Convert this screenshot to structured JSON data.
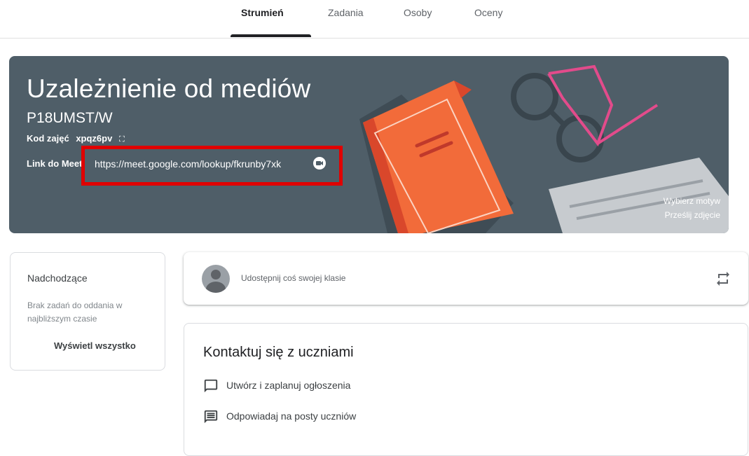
{
  "tabs": [
    {
      "label": "Strumień",
      "active": true
    },
    {
      "label": "Zadania",
      "active": false
    },
    {
      "label": "Osoby",
      "active": false
    },
    {
      "label": "Oceny",
      "active": false
    }
  ],
  "banner": {
    "title": "Uzależnienie od mediów",
    "section": "P18UMST/W",
    "code_label": "Kod zajęć",
    "code_value": "xpqz6pv",
    "link_label": "Link do Meet",
    "link_url": "https://meet.google.com/lookup/fkrunby7xk",
    "select_theme": "Wybierz motyw",
    "upload_photo": "Prześlij zdjęcie",
    "background_color": "#4f5e68"
  },
  "upcoming": {
    "heading": "Nadchodzące",
    "empty_text": "Brak zadań do oddania w najbliższym czasie",
    "view_all": "Wyświetl wszystko"
  },
  "share": {
    "placeholder": "Udostępnij coś swojej klasie"
  },
  "contact": {
    "heading": "Kontaktuj się z uczniami",
    "items": [
      {
        "icon": "announcement-icon",
        "label": "Utwórz i zaplanuj ogłoszenia"
      },
      {
        "icon": "comments-icon",
        "label": "Odpowiadaj na posty uczniów"
      }
    ]
  },
  "colors": {
    "highlight": "#e00000",
    "book": "#f26b3a"
  }
}
